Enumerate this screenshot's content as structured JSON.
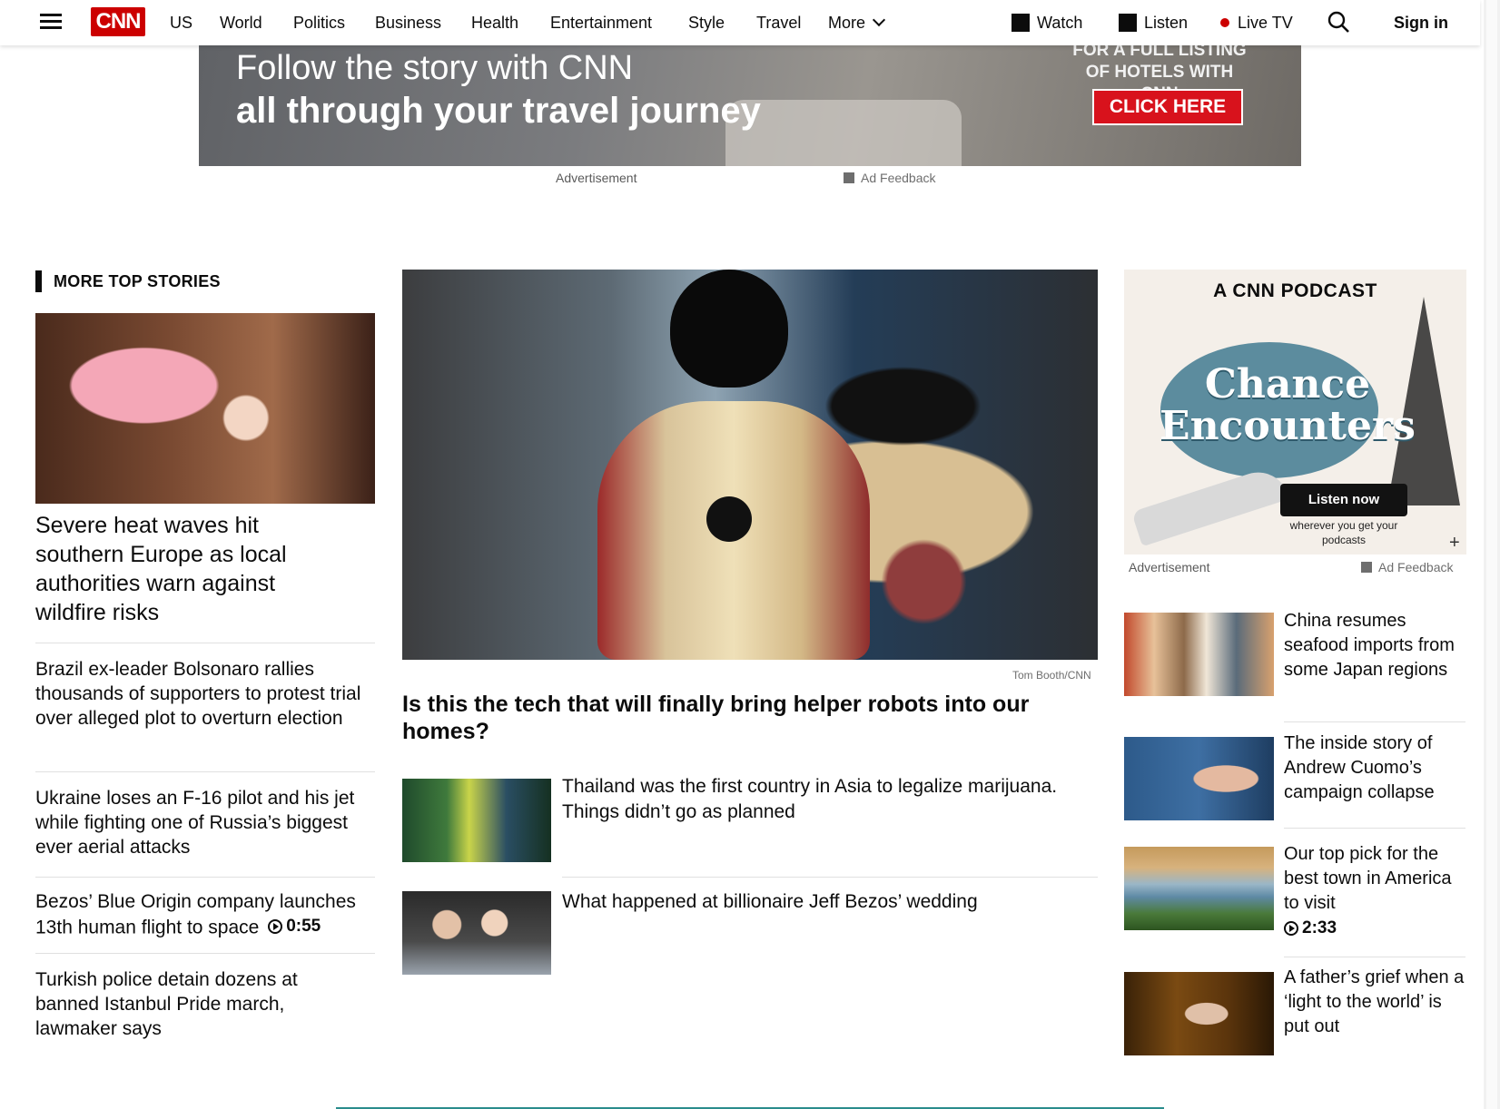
{
  "header": {
    "logo_text": "CNN",
    "nav": [
      "US",
      "World",
      "Politics",
      "Business",
      "Health",
      "Entertainment",
      "Style",
      "Travel",
      "More"
    ],
    "watch": "Watch",
    "listen": "Listen",
    "live_tv": "Live TV",
    "sign_in": "Sign in"
  },
  "top_ad": {
    "line1": "Follow the story with CNN",
    "line2": "all through your travel journey",
    "listing": "FOR A FULL LISTING OF HOTELS WITH CNN",
    "cta": "CLICK HERE",
    "advertisement_label": "Advertisement",
    "feedback": "Ad Feedback"
  },
  "left": {
    "section_title": "MORE TOP STORIES",
    "lead_headline": "Severe heat waves hit southern Europe as local authorities warn against wildfire risks",
    "stories": [
      {
        "text": "Brazil ex-leader Bolsonaro rallies thousands of supporters to protest trial over alleged plot to overturn election"
      },
      {
        "text": "Ukraine loses an F-16 pilot and his jet while fighting one of Russia’s biggest ever aerial attacks"
      },
      {
        "text": "Bezos’ Blue Origin company launches 13th human flight to space",
        "video": "0:55"
      },
      {
        "text": "Turkish police detain dozens at banned Istanbul Pride march, lawmaker says"
      }
    ]
  },
  "center": {
    "photo_credit": "Tom Booth/CNN",
    "lead_headline": "Is this the tech that will finally bring helper robots into our homes?",
    "stories": [
      {
        "text": "Thailand was the first country in Asia to legalize marijuana. Things didn’t go as planned"
      },
      {
        "text": "What happened at billionaire Jeff Bezos’ wedding"
      }
    ]
  },
  "right": {
    "podcast": {
      "brand": "A CNN PODCAST",
      "title_line1": "Chance",
      "title_line2": "Encounters",
      "cta": "Listen now",
      "sub": "wherever you get your podcasts"
    },
    "advertisement_label": "Advertisement",
    "feedback": "Ad Feedback",
    "stories": [
      {
        "text": "China resumes seafood imports from some Japan regions"
      },
      {
        "text": "The inside story of Andrew Cuomo’s campaign collapse"
      },
      {
        "text": "Our top pick for the best town in America to visit",
        "video": "2:33"
      },
      {
        "text": "A father’s grief when a ‘light to the world’ is put out"
      }
    ]
  }
}
